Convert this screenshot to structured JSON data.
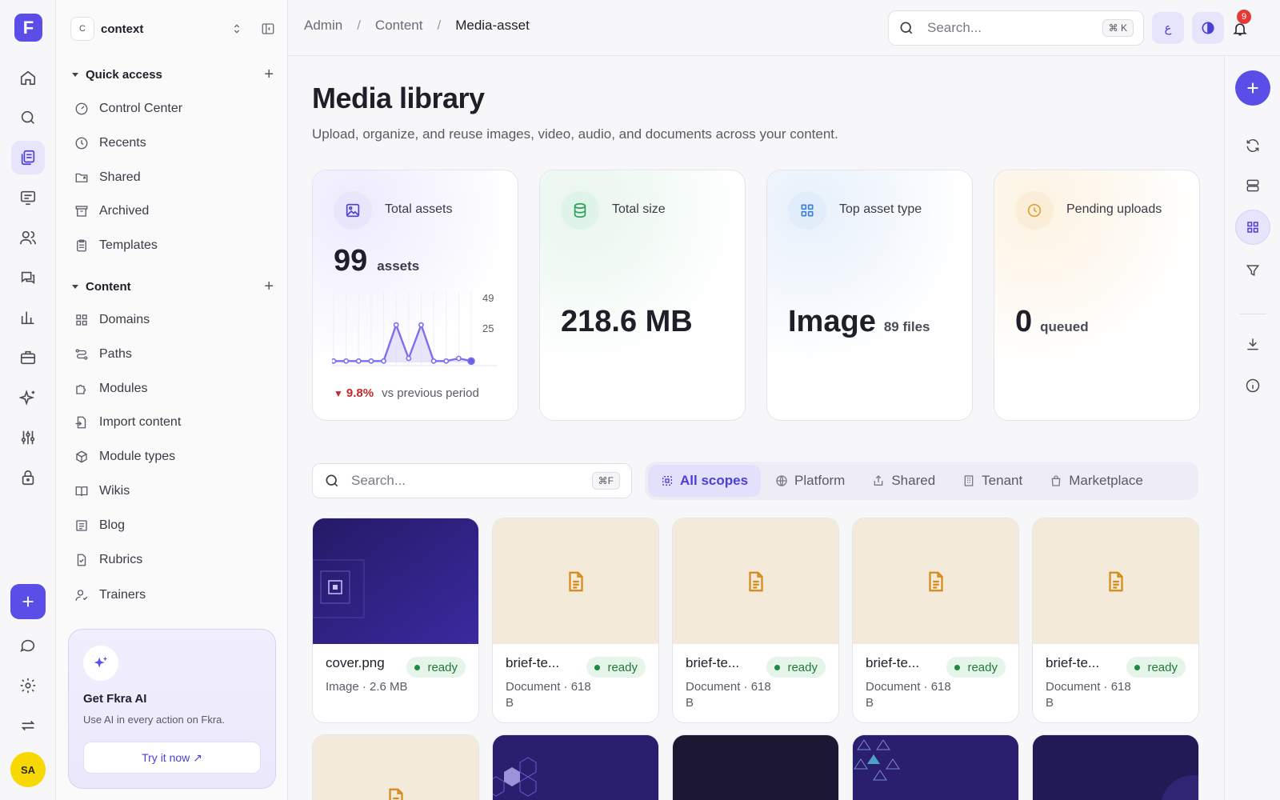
{
  "rail": {
    "logo": "F",
    "items": [
      {
        "icon": "home-icon"
      },
      {
        "icon": "search-icon"
      },
      {
        "icon": "content-icon",
        "active": true
      },
      {
        "icon": "review-icon"
      },
      {
        "icon": "users-icon"
      },
      {
        "icon": "chat-icon"
      },
      {
        "icon": "chart-icon"
      },
      {
        "icon": "briefcase-icon"
      },
      {
        "icon": "sparkles-icon"
      },
      {
        "icon": "sliders-icon"
      },
      {
        "icon": "lock-icon"
      }
    ],
    "bottom": [
      {
        "icon": "message-icon"
      },
      {
        "icon": "settings-icon"
      },
      {
        "icon": "switch-icon"
      }
    ],
    "avatar": "SA"
  },
  "sidebar": {
    "workspace_badge": "C",
    "workspace_name": "context",
    "quick_access": {
      "title": "Quick access",
      "items": [
        "Control Center",
        "Recents",
        "Shared",
        "Archived",
        "Templates"
      ]
    },
    "content": {
      "title": "Content",
      "items": [
        "Domains",
        "Paths",
        "Modules",
        "Import content",
        "Module types",
        "Wikis",
        "Blog",
        "Rubrics",
        "Trainers"
      ]
    },
    "ai": {
      "title": "Get Fkra AI",
      "subtitle": "Use AI in every action on Fkra.",
      "button": "Try it now ↗"
    }
  },
  "header": {
    "breadcrumbs": [
      "Admin",
      "Content",
      "Media-asset"
    ],
    "search_placeholder": "Search...",
    "search_shortcut": "⌘ K",
    "lang_button": "ع",
    "notifications": "9"
  },
  "page": {
    "title": "Media library",
    "subtitle": "Upload, organize, and reuse images, video, audio, and documents across your content."
  },
  "stats": {
    "total_assets": {
      "label": "Total assets",
      "value": "99",
      "unit": "assets",
      "trend_pct": "9.8%",
      "trend_text": "vs previous period",
      "axis_max": "49",
      "axis_mid": "25"
    },
    "total_size": {
      "label": "Total size",
      "value": "218.6 MB"
    },
    "top_type": {
      "label": "Top asset type",
      "value": "Image",
      "unit": "89 files"
    },
    "pending": {
      "label": "Pending uploads",
      "value": "0",
      "unit": "queued"
    }
  },
  "sparkline": [
    1,
    1,
    1,
    1,
    1,
    28,
    3,
    28,
    1,
    1,
    3,
    1
  ],
  "filters": {
    "search_placeholder": "Search...",
    "search_shortcut": "⌘F",
    "scopes": [
      "All scopes",
      "Platform",
      "Shared",
      "Tenant",
      "Marketplace"
    ],
    "active_scope": "All scopes"
  },
  "assets": [
    {
      "name": "cover.png",
      "type": "Image · 2.6 MB",
      "status": "ready",
      "thumb": "img"
    },
    {
      "name": "brief-te...",
      "type": "Document · 618 B",
      "status": "ready",
      "thumb": "doc"
    },
    {
      "name": "brief-te...",
      "type": "Document · 618 B",
      "status": "ready",
      "thumb": "doc"
    },
    {
      "name": "brief-te...",
      "type": "Document · 618 B",
      "status": "ready",
      "thumb": "doc"
    },
    {
      "name": "brief-te...",
      "type": "Document · 618 B",
      "status": "ready",
      "thumb": "doc"
    }
  ],
  "colors": {
    "accent": "#5b4ee8",
    "ready": "#1f7a3a",
    "down": "#c62828"
  }
}
